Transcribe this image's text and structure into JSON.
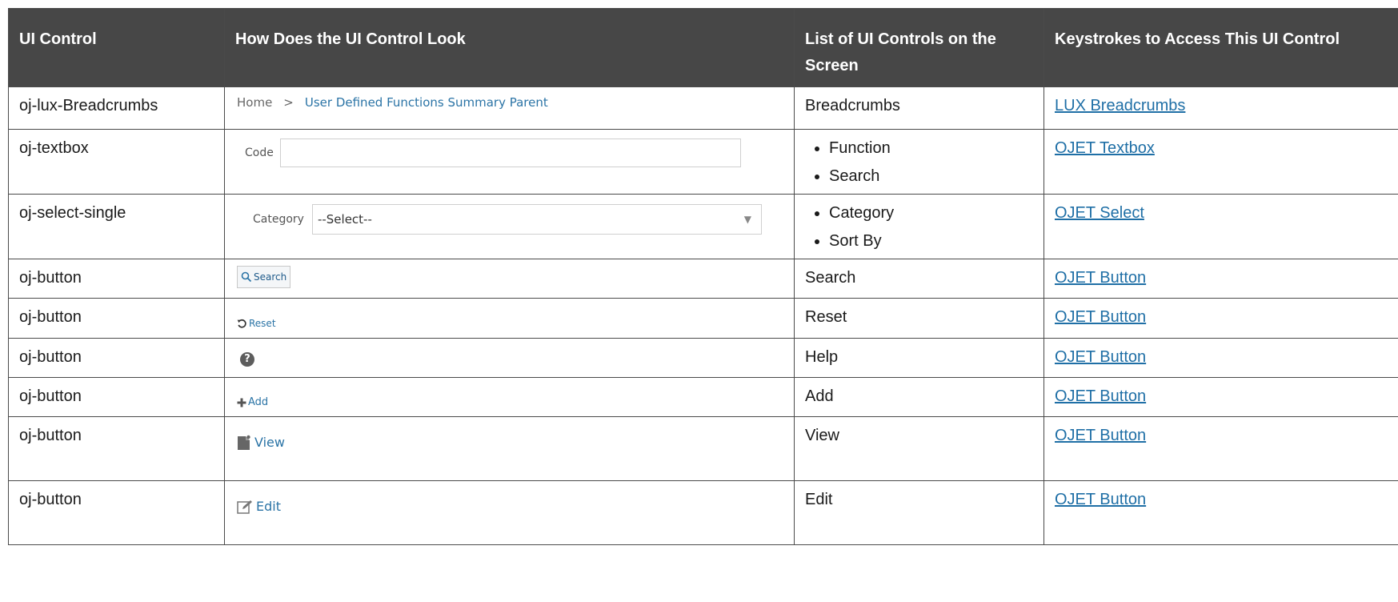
{
  "table": {
    "headers": [
      "UI Control",
      "How Does the UI Control Look",
      "List of UI Controls on the Screen",
      "Keystrokes to Access This UI Control"
    ],
    "rows": [
      {
        "control": "oj-lux-Breadcrumbs",
        "controls_text": "Breadcrumbs",
        "link": "LUX Breadcrumbs"
      },
      {
        "control": "oj-textbox",
        "controls_list": [
          "Function",
          "Search"
        ],
        "link": "OJET Textbox"
      },
      {
        "control": "oj-select-single",
        "controls_list": [
          "Category",
          "Sort By"
        ],
        "link": "OJET Select"
      },
      {
        "control": "oj-button",
        "controls_text": "Search",
        "link": "OJET Button"
      },
      {
        "control": "oj-button",
        "controls_text": "Reset",
        "link": "OJET Button"
      },
      {
        "control": "oj-button",
        "controls_text": "Help",
        "link": "OJET Button"
      },
      {
        "control": "oj-button",
        "controls_text": "Add",
        "link": "OJET Button"
      },
      {
        "control": "oj-button",
        "controls_text": "View",
        "link": "OJET Button"
      },
      {
        "control": "oj-button",
        "controls_text": "Edit",
        "link": "OJET Button"
      }
    ]
  },
  "samples": {
    "breadcrumb_home": "Home",
    "breadcrumb_sep": ">",
    "breadcrumb_current": "User Defined Functions Summary Parent",
    "textbox_label": "Code",
    "select_label": "Category",
    "select_value": "--Select--",
    "search_label": "Search",
    "reset_label": "Reset",
    "help_glyph": "?",
    "add_label": "Add",
    "view_label": "View",
    "edit_label": "Edit"
  },
  "colors": {
    "header_bg": "#474747",
    "link": "#1f6fa6",
    "icon_blue": "#2b74a6"
  }
}
